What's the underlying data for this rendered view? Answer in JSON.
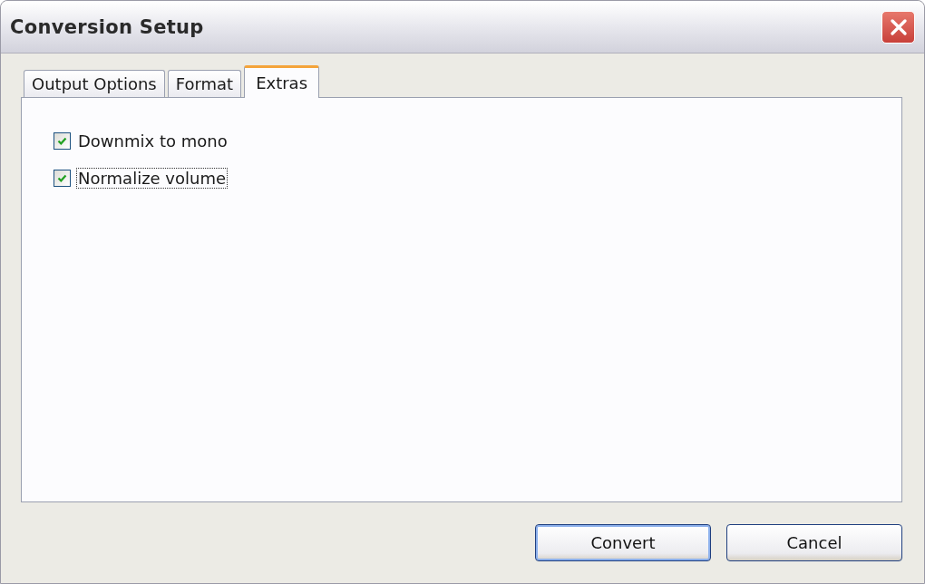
{
  "window": {
    "title": "Conversion Setup"
  },
  "tabs": [
    {
      "label": "Output Options",
      "selected": false
    },
    {
      "label": "Format",
      "selected": false
    },
    {
      "label": "Extras",
      "selected": true
    }
  ],
  "options": [
    {
      "label": "Downmix to mono",
      "checked": true,
      "focused": false
    },
    {
      "label": "Normalize volume",
      "checked": true,
      "focused": true
    }
  ],
  "buttons": [
    {
      "label": "Convert",
      "default": true
    },
    {
      "label": "Cancel",
      "default": false
    }
  ]
}
